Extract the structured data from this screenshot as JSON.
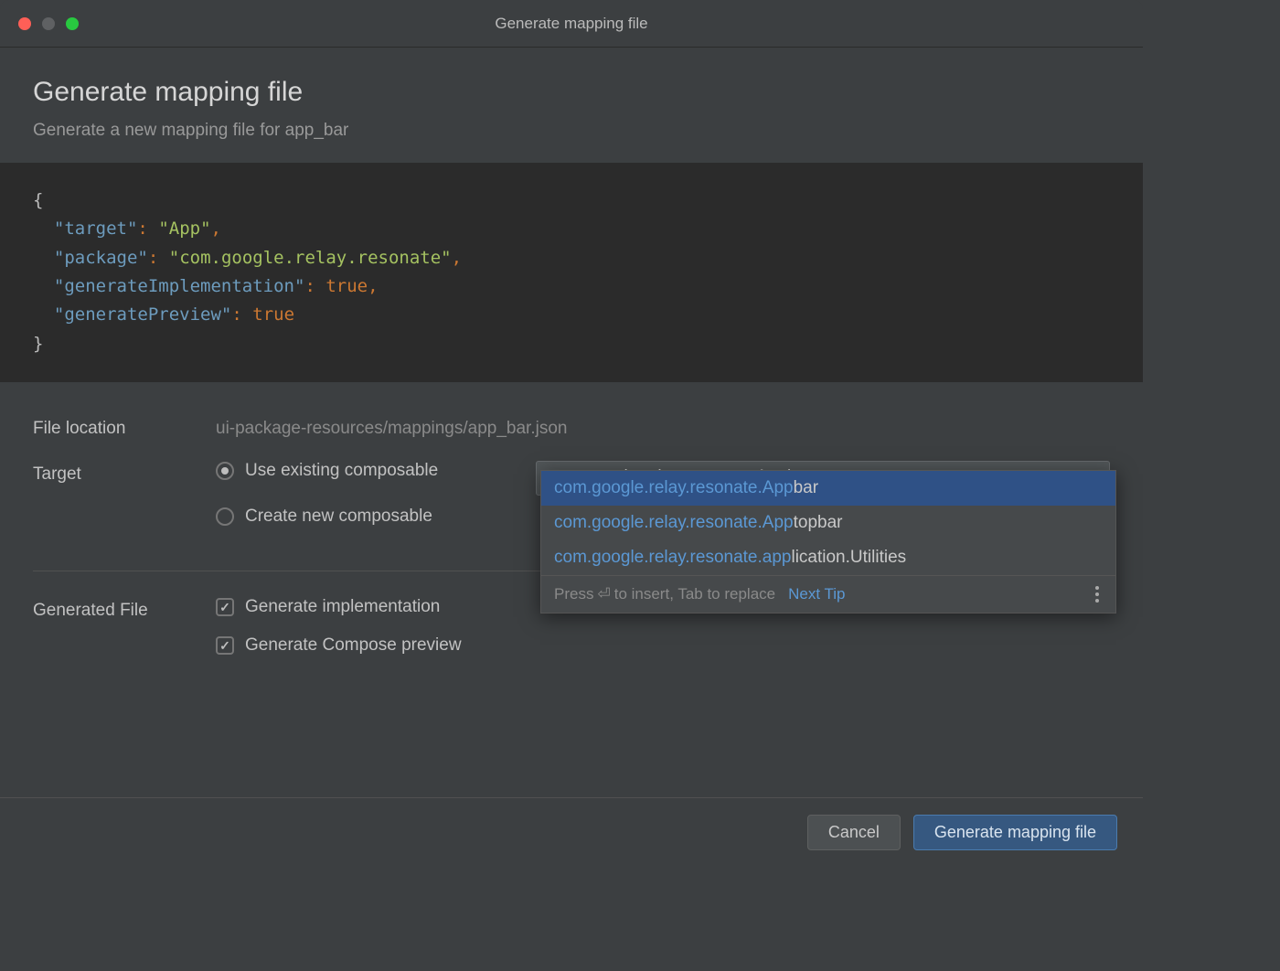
{
  "titlebar": {
    "title": "Generate mapping file"
  },
  "header": {
    "title": "Generate mapping file",
    "subtitle": "Generate a new mapping file for app_bar"
  },
  "code": {
    "target_key": "\"target\"",
    "target_val": "\"App\"",
    "package_key": "\"package\"",
    "package_val": "\"com.google.relay.resonate\"",
    "genimpl_key": "\"generateImplementation\"",
    "genimpl_val": "true",
    "genprev_key": "\"generatePreview\"",
    "genprev_val": "true"
  },
  "form": {
    "file_location_label": "File location",
    "file_location_value": "ui-package-resources/mappings/app_bar.json",
    "target_label": "Target",
    "target_value": "com.google.relay.resonate.App",
    "radio_existing": "Use existing composable",
    "radio_new": "Create new composable",
    "generated_file_label": "Generated File",
    "check_impl": "Generate implementation",
    "check_preview": "Generate Compose preview"
  },
  "autocomplete": {
    "items": [
      {
        "match": "com.google.relay.resonate.App",
        "rest": "bar"
      },
      {
        "match": "com.google.relay.resonate.App",
        "rest": "topbar"
      },
      {
        "match": "com.google.relay.resonate.app",
        "rest": "lication.Utilities"
      }
    ],
    "hint_prefix": "Press ",
    "hint_mid": " to insert, Tab to replace",
    "next_tip": "Next Tip"
  },
  "footer": {
    "cancel": "Cancel",
    "confirm": "Generate mapping file"
  }
}
